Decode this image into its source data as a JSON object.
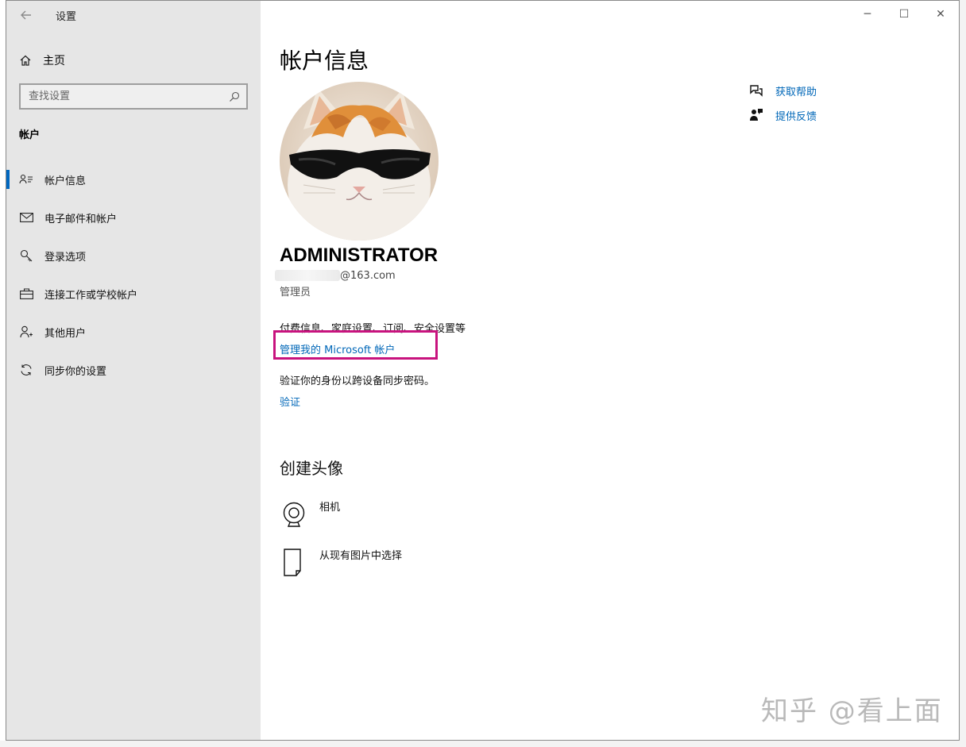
{
  "window": {
    "title": "设置"
  },
  "sidebar": {
    "home_label": "主页",
    "search": {
      "placeholder": "查找设置"
    },
    "section_label": "帐户",
    "items": [
      {
        "label": "帐户信息",
        "icon": "person-card-icon",
        "active": true
      },
      {
        "label": "电子邮件和帐户",
        "icon": "mail-icon"
      },
      {
        "label": "登录选项",
        "icon": "key-icon"
      },
      {
        "label": "连接工作或学校帐户",
        "icon": "briefcase-icon"
      },
      {
        "label": "其他用户",
        "icon": "person-add-icon"
      },
      {
        "label": "同步你的设置",
        "icon": "sync-icon"
      }
    ]
  },
  "main": {
    "title": "帐户信息",
    "user": {
      "name": "ADMINISTRATOR",
      "email_suffix": "@163.com",
      "role": "管理员"
    },
    "info_line": "付费信息、家庭设置、订阅、安全设置等",
    "manage_link": "管理我的 Microsoft 帐户",
    "verify_desc": "验证你的身份以跨设备同步密码。",
    "verify_link": "验证",
    "create_avatar": {
      "title": "创建头像",
      "options": [
        {
          "label": "相机",
          "icon": "camera-icon"
        },
        {
          "label": "从现有图片中选择",
          "icon": "file-icon"
        }
      ]
    },
    "help": {
      "get_help": "获取帮助",
      "feedback": "提供反馈"
    }
  },
  "watermark": "知乎 @看上面",
  "colors": {
    "accent": "#0067c0",
    "link": "#0067b8",
    "highlight_box": "#c8137e",
    "sidebar_bg": "#e6e6e6"
  }
}
